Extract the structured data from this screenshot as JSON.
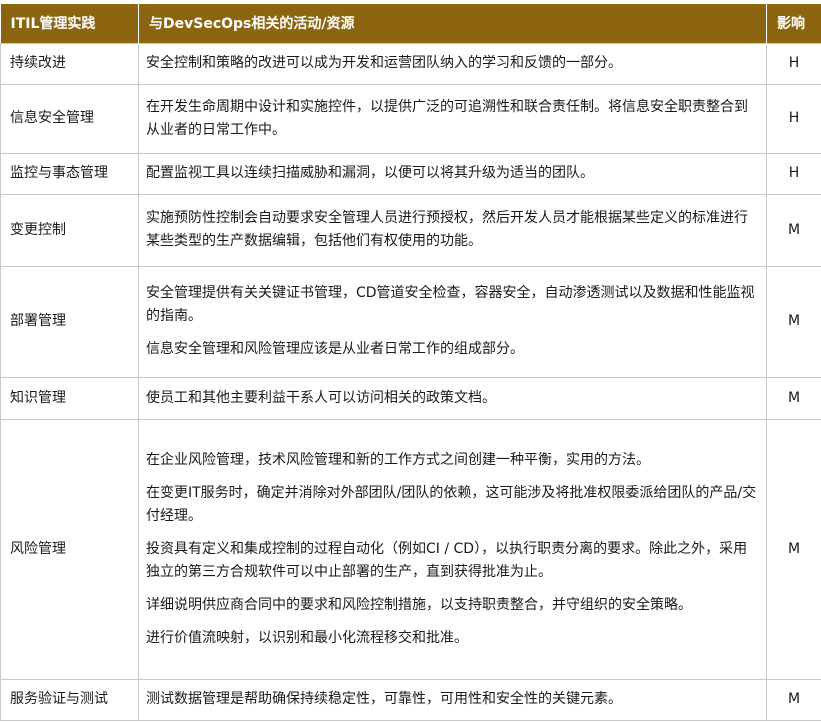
{
  "header": {
    "practice": "ITIL管理实践",
    "activities": "与DevSecOps相关的活动/资源",
    "impact": "影响"
  },
  "rows": [
    {
      "practice": "持续改进",
      "activities": [
        "安全控制和策略的改进可以成为开发和运营团队纳入的学习和反馈的一部分。"
      ],
      "impact": "H"
    },
    {
      "practice": "信息安全管理",
      "activities": [
        "在开发生命周期中设计和实施控件，以提供广泛的可追溯性和联合责任制。将信息安全职责整合到从业者的日常工作中。"
      ],
      "impact": "H"
    },
    {
      "practice": "监控与事态管理",
      "activities": [
        "配置监视工具以连续扫描威胁和漏洞，以便可以将其升级为适当的团队。"
      ],
      "impact": "H"
    },
    {
      "practice": "变更控制",
      "activities": [
        "实施预防性控制会自动要求安全管理人员进行预授权，然后开发人员才能根据某些定义的标准进行某些类型的生产数据编辑，包括他们有权使用的功能。"
      ],
      "impact": "M"
    },
    {
      "practice": "部署管理",
      "activities": [
        "安全管理提供有关关键证书管理，CD管道安全检查，容器安全，自动渗透测试以及数据和性能监视的指南。",
        "信息安全管理和风险管理应该是从业者日常工作的组成部分。"
      ],
      "impact": "M"
    },
    {
      "practice": "知识管理",
      "activities": [
        "使员工和其他主要利益干系人可以访问相关的政策文档。"
      ],
      "impact": "M"
    },
    {
      "practice": "风险管理",
      "activities": [
        "在企业风险管理，技术风险管理和新的工作方式之间创建一种平衡，实用的方法。",
        "在变更IT服务时，确定并消除对外部团队/团队的依赖，这可能涉及将批准权限委派给团队的产品/交付经理。",
        "投资具有定义和集成控制的过程自动化（例如CI / CD），以执行职责分离的要求。除此之外，采用独立的第三方合规软件可以中止部署的生产，直到获得批准为止。",
        "详细说明供应商合同中的要求和风险控制措施，以支持职责整合，并守组织的安全策略。",
        "进行价值流映射，以识别和最小化流程移交和批准。"
      ],
      "impact": "M"
    },
    {
      "practice": "服务验证与测试",
      "activities": [
        "测试数据管理是帮助确保持续稳定性，可靠性，可用性和安全性的关键元素。"
      ],
      "impact": "M"
    }
  ]
}
